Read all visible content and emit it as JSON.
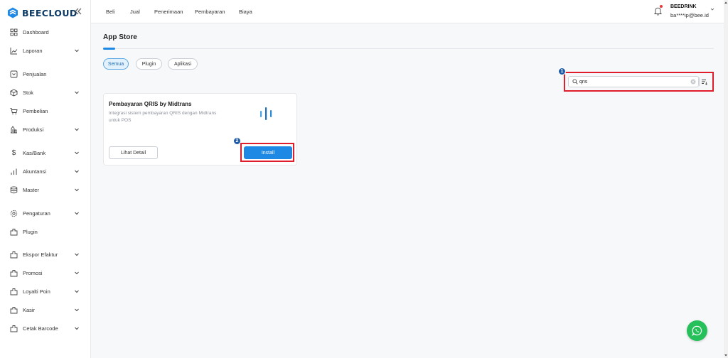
{
  "brand": {
    "name": "BEECLOUD",
    "accent": "#1e88e5",
    "logo_color": "#0d3b66"
  },
  "sidebar": {
    "collapse_icon": "double-chevron-left-icon",
    "items": [
      {
        "label": "Dashboard",
        "icon": "grid-icon",
        "expandable": false
      },
      {
        "label": "Laporan",
        "icon": "line-chart-icon",
        "expandable": true
      },
      {
        "label": "Penjualan",
        "icon": "invoice-icon",
        "expandable": false
      },
      {
        "label": "Stok",
        "icon": "box-icon",
        "expandable": true
      },
      {
        "label": "Pembelian",
        "icon": "cart-icon",
        "expandable": false
      },
      {
        "label": "Produksi",
        "icon": "factory-icon",
        "expandable": true
      },
      {
        "label": "Kas/Bank",
        "icon": "dollar-icon",
        "expandable": true
      },
      {
        "label": "Akuntansi",
        "icon": "bar-chart-icon",
        "expandable": true
      },
      {
        "label": "Master",
        "icon": "database-icon",
        "expandable": true
      },
      {
        "label": "Pengaturan",
        "icon": "gear-icon",
        "expandable": true
      },
      {
        "label": "Plugin",
        "icon": "plugin-icon",
        "expandable": false
      },
      {
        "label": "Ekspor Efaktur",
        "icon": "plugin-icon",
        "expandable": true
      },
      {
        "label": "Promosi",
        "icon": "plugin-icon",
        "expandable": true
      },
      {
        "label": "Loyalti Poin",
        "icon": "plugin-icon",
        "expandable": true
      },
      {
        "label": "Kasir",
        "icon": "plugin-icon",
        "expandable": true
      },
      {
        "label": "Cetak Barcode",
        "icon": "plugin-icon",
        "expandable": true
      }
    ]
  },
  "topbar": {
    "menu": [
      "Beli",
      "Jual",
      "Penerimaan",
      "Pembayaran",
      "Biaya"
    ],
    "user": {
      "name": "BEEDRINK",
      "email": "ba****ip@bee.id"
    }
  },
  "main": {
    "title": "App Store",
    "filters": [
      {
        "label": "Semua",
        "active": true
      },
      {
        "label": "Plugin",
        "active": false
      },
      {
        "label": "Aplikasi",
        "active": false
      }
    ],
    "search": {
      "value": "qris",
      "placeholder": ""
    },
    "annotations": {
      "step1": "1",
      "step2": "2"
    },
    "card": {
      "title": "Pembayaran QRIS by Midtrans",
      "description": "Integrasi sistem pembayaran QRIS dengan Midtrans untuk POS",
      "detail_label": "Lihat Detail",
      "install_label": "Install"
    }
  },
  "colors": {
    "highlight": "#e01e2b",
    "whatsapp": "#25c05a",
    "badge": "#1e5aa8"
  }
}
